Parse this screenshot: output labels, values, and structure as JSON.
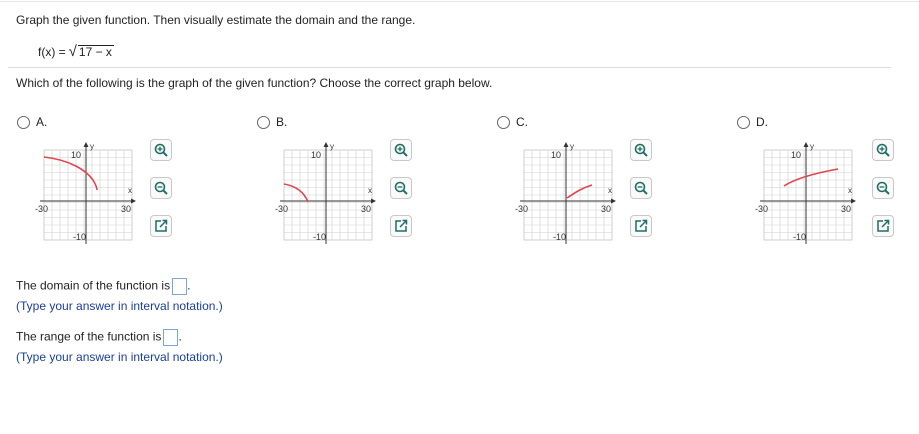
{
  "prompt": "Graph the given function. Then visually estimate the domain and the range.",
  "function": {
    "lhs": "f(x) = ",
    "radicand": "17 − x"
  },
  "question": "Which of the following is the graph of the given function? Choose the correct graph below.",
  "options": [
    {
      "label": "A.",
      "curve": "reflect-x-left"
    },
    {
      "label": "B.",
      "curve": "reflect-both-left"
    },
    {
      "label": "C.",
      "curve": "shifted-right-up"
    },
    {
      "label": "D.",
      "curve": "shifted-left-up"
    }
  ],
  "axis": {
    "x_label": "x",
    "y_label": "y",
    "x_min_label": "-30",
    "x_max_label": "30",
    "y_max_label": "10",
    "y_min_label": "-10"
  },
  "domain": {
    "text": "The domain of the function is",
    "hint": "(Type your answer in interval notation.)"
  },
  "range": {
    "text": "The range of the function is",
    "hint": "(Type your answer in interval notation.)"
  },
  "icons": [
    "zoom-in-icon",
    "zoom-out-icon",
    "expand-icon"
  ],
  "colors": {
    "curve": "#e0454d",
    "hint": "#1a3e9c",
    "grid": "#cfcfcf",
    "icon": "#1d6e63"
  }
}
